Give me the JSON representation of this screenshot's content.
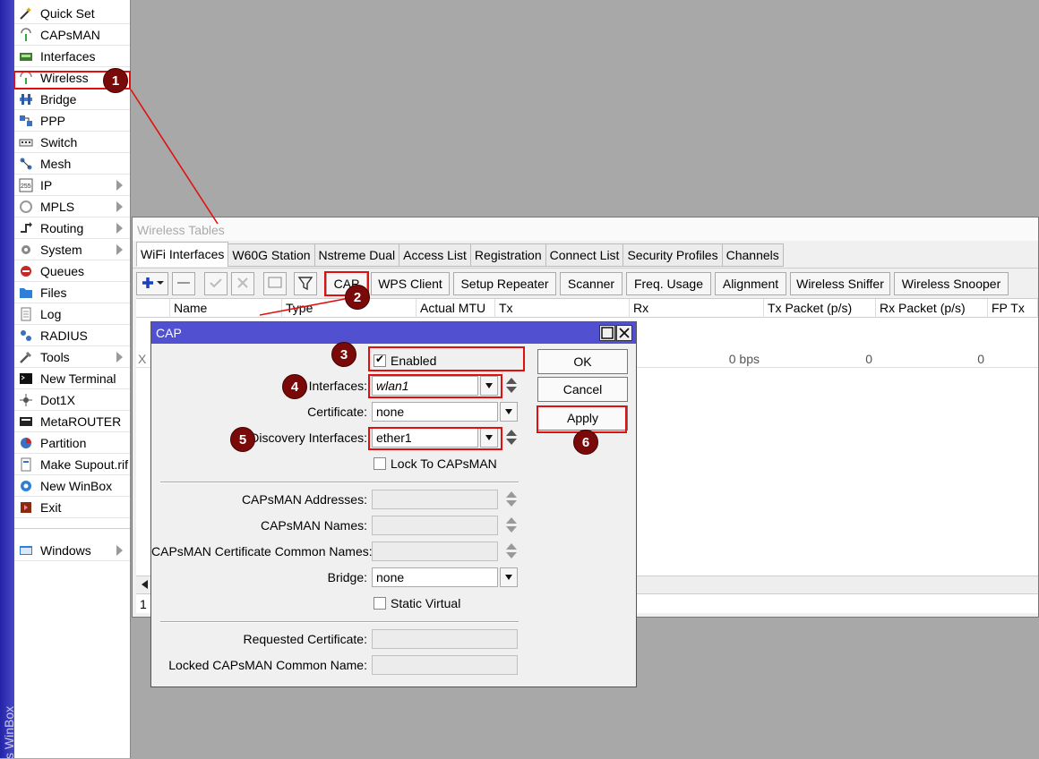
{
  "app_vertical_label": "s WinBox",
  "menu": [
    {
      "label": "Quick Set",
      "icon": "wand-icon"
    },
    {
      "label": "CAPsMAN",
      "icon": "antenna-icon"
    },
    {
      "label": "Interfaces",
      "icon": "interfaces-icon"
    },
    {
      "label": "Wireless",
      "icon": "wireless-icon"
    },
    {
      "label": "Bridge",
      "icon": "bridge-icon"
    },
    {
      "label": "PPP",
      "icon": "ppp-icon"
    },
    {
      "label": "Switch",
      "icon": "switch-icon"
    },
    {
      "label": "Mesh",
      "icon": "mesh-icon"
    },
    {
      "label": "IP",
      "icon": "ip-icon",
      "submenu": true
    },
    {
      "label": "MPLS",
      "icon": "mpls-icon",
      "submenu": true
    },
    {
      "label": "Routing",
      "icon": "routing-icon",
      "submenu": true
    },
    {
      "label": "System",
      "icon": "gear-icon",
      "submenu": true
    },
    {
      "label": "Queues",
      "icon": "queues-icon"
    },
    {
      "label": "Files",
      "icon": "folder-icon"
    },
    {
      "label": "Log",
      "icon": "log-icon"
    },
    {
      "label": "RADIUS",
      "icon": "radius-icon"
    },
    {
      "label": "Tools",
      "icon": "tools-icon",
      "submenu": true
    },
    {
      "label": "New Terminal",
      "icon": "terminal-icon"
    },
    {
      "label": "Dot1X",
      "icon": "dot1x-icon"
    },
    {
      "label": "MetaROUTER",
      "icon": "metarouter-icon"
    },
    {
      "label": "Partition",
      "icon": "partition-icon"
    },
    {
      "label": "Make Supout.rif",
      "icon": "supout-icon"
    },
    {
      "label": "New WinBox",
      "icon": "winbox-icon"
    },
    {
      "label": "Exit",
      "icon": "exit-icon"
    },
    {
      "label": "Windows",
      "icon": "windows-icon",
      "submenu": true
    }
  ],
  "wireless_tables": {
    "title": "Wireless Tables",
    "tabs": [
      "WiFi Interfaces",
      "W60G Station",
      "Nstreme Dual",
      "Access List",
      "Registration",
      "Connect List",
      "Security Profiles",
      "Channels"
    ],
    "toolbar": {
      "cap": "CAP",
      "wps_client": "WPS Client",
      "setup_repeater": "Setup Repeater",
      "scanner": "Scanner",
      "freq_usage": "Freq. Usage",
      "alignment": "Alignment",
      "wireless_sniffer": "Wireless Sniffer",
      "wireless_snooper": "Wireless Snooper"
    },
    "columns": [
      "Name",
      "Type",
      "Actual MTU",
      "Tx",
      "Rx",
      "Tx Packet (p/s)",
      "Rx Packet (p/s)",
      "FP Tx"
    ],
    "row": {
      "flag": "X",
      "rx": "0 bps",
      "tx_packet": "0",
      "rx_packet": "0"
    },
    "status": "1 i"
  },
  "cap_dialog": {
    "title": "CAP",
    "enabled_label": "Enabled",
    "enabled": true,
    "interfaces_label": "Interfaces:",
    "interfaces_value": "wlan1",
    "certificate_label": "Certificate:",
    "certificate_value": "none",
    "discovery_label": "Discovery Interfaces:",
    "discovery_value": "ether1",
    "lock_label": "Lock To CAPsMAN",
    "capsman_addresses_label": "CAPsMAN Addresses:",
    "capsman_names_label": "CAPsMAN Names:",
    "capsman_cert_names_label": "CAPsMAN Certificate Common Names:",
    "bridge_label": "Bridge:",
    "bridge_value": "none",
    "static_virtual_label": "Static Virtual",
    "requested_cert_label": "Requested Certificate:",
    "locked_names_label": "Locked CAPsMAN Common Name:",
    "ok": "OK",
    "cancel": "Cancel",
    "apply": "Apply"
  },
  "annotations": [
    "1",
    "2",
    "3",
    "4",
    "5",
    "6"
  ],
  "colors": {
    "annotation_red": "#e01010",
    "badge": "#7a0a0a",
    "dialog_title": "#5050d0",
    "strip": "#2323a8"
  }
}
